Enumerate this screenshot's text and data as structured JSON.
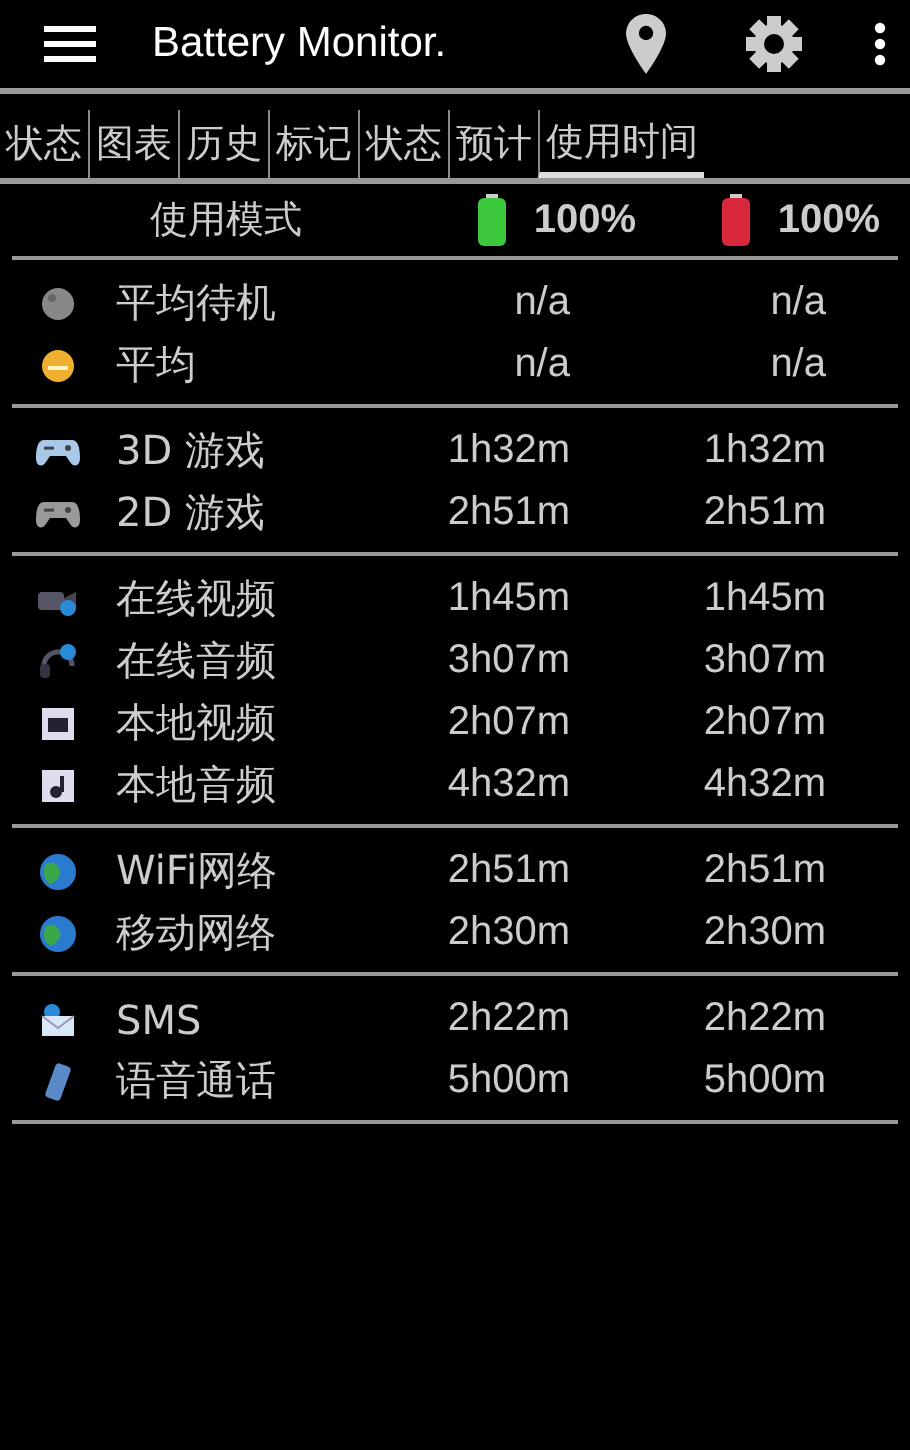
{
  "app_bar": {
    "title": "Battery Monitor."
  },
  "tabs": [
    {
      "label": "状态",
      "selected": false
    },
    {
      "label": "图表",
      "selected": false
    },
    {
      "label": "历史",
      "selected": false
    },
    {
      "label": "标记",
      "selected": false
    },
    {
      "label": "状态",
      "selected": false
    },
    {
      "label": "预计",
      "selected": false
    },
    {
      "label": "使用时间",
      "selected": true
    }
  ],
  "table": {
    "header": "使用模式",
    "columns": [
      {
        "color": "#3cc83c",
        "value": "100%"
      },
      {
        "color": "#d8283c",
        "value": "100%"
      }
    ],
    "groups": [
      {
        "rows": [
          {
            "kind": "moon",
            "name": "平均待机",
            "values": [
              "n/a",
              "n/a"
            ]
          },
          {
            "kind": "sun",
            "name": "平均",
            "values": [
              "n/a",
              "n/a"
            ]
          }
        ]
      },
      {
        "rows": [
          {
            "kind": "gamepad-light",
            "name": "3D 游戏",
            "values": [
              "1h32m",
              "1h32m"
            ]
          },
          {
            "kind": "gamepad-grey",
            "name": "2D 游戏",
            "values": [
              "2h51m",
              "2h51m"
            ]
          }
        ]
      },
      {
        "rows": [
          {
            "kind": "camera",
            "name": "在线视频",
            "values": [
              "1h45m",
              "1h45m"
            ]
          },
          {
            "kind": "headphones",
            "name": "在线音频",
            "values": [
              "3h07m",
              "3h07m"
            ]
          },
          {
            "kind": "film",
            "name": "本地视频",
            "values": [
              "2h07m",
              "2h07m"
            ]
          },
          {
            "kind": "music",
            "name": "本地音频",
            "values": [
              "4h32m",
              "4h32m"
            ]
          }
        ]
      },
      {
        "rows": [
          {
            "kind": "globe",
            "name": "WiFi网络",
            "values": [
              "2h51m",
              "2h51m"
            ]
          },
          {
            "kind": "globe",
            "name": "移动网络",
            "values": [
              "2h30m",
              "2h30m"
            ]
          }
        ]
      },
      {
        "rows": [
          {
            "kind": "envelope",
            "name": "SMS",
            "values": [
              "2h22m",
              "2h22m"
            ]
          },
          {
            "kind": "phone",
            "name": "语音通话",
            "values": [
              "5h00m",
              "5h00m"
            ]
          }
        ]
      }
    ]
  }
}
